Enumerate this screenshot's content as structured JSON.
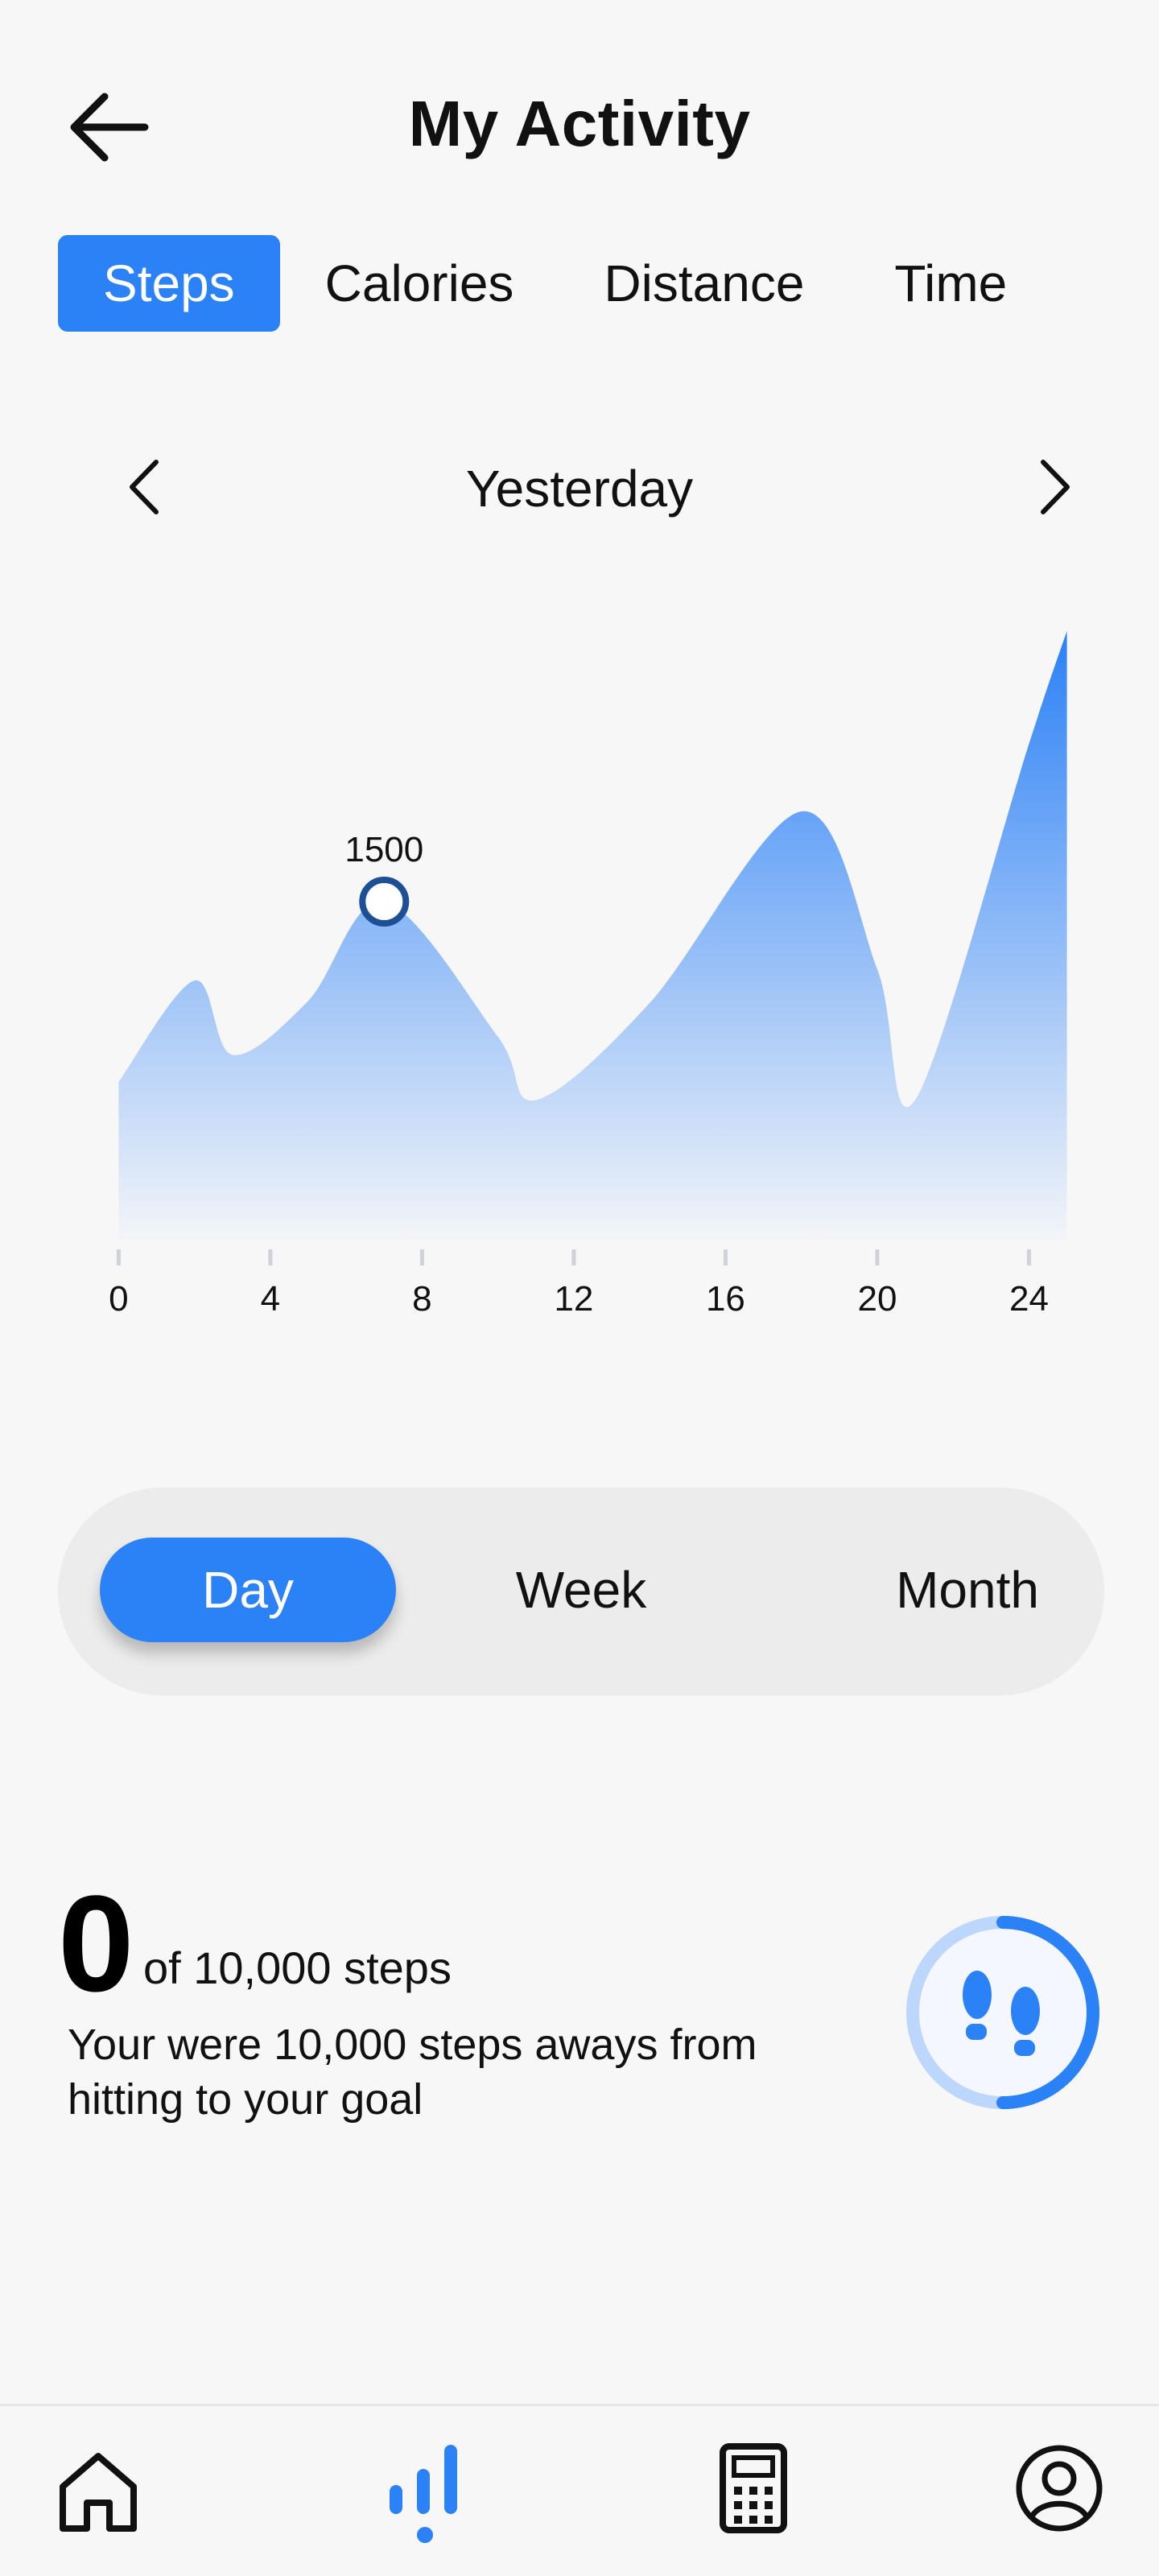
{
  "header": {
    "title": "My Activity",
    "back_icon": "arrow-left-icon"
  },
  "tabs": [
    {
      "label": "Steps",
      "active": true
    },
    {
      "label": "Calories",
      "active": false
    },
    {
      "label": "Distance",
      "active": false
    },
    {
      "label": "Time",
      "active": false
    }
  ],
  "date_nav": {
    "label": "Yesterday",
    "prev_icon": "chevron-left-icon",
    "next_icon": "chevron-right-icon"
  },
  "chart_data": {
    "type": "area",
    "x": [
      0,
      2,
      3,
      5,
      7,
      10,
      11,
      14,
      18,
      20,
      21,
      24,
      25
    ],
    "y": [
      700,
      1150,
      820,
      1060,
      1500,
      900,
      620,
      1050,
      1900,
      1200,
      620,
      2200,
      2700
    ],
    "ticks": [
      0,
      4,
      8,
      12,
      16,
      20,
      24
    ],
    "xlim": [
      -1.6,
      25.9
    ],
    "ylim": [
      0,
      3000
    ],
    "highlight": {
      "x": 7,
      "y": 1500,
      "label": "1500"
    },
    "grid": false,
    "fill_color": "#2b81f6"
  },
  "period": {
    "options": [
      {
        "label": "Day",
        "active": true
      },
      {
        "label": "Week",
        "active": false
      },
      {
        "label": "Month",
        "active": false
      }
    ]
  },
  "summary": {
    "count": "0",
    "goal_text": "of 10,000 steps",
    "message": "Your were 10,000 steps aways from hitting to your goal",
    "progress_fraction": 0.5,
    "icon": "footprints-icon"
  },
  "bottom_nav": {
    "items": [
      {
        "icon": "home-icon",
        "active": false
      },
      {
        "icon": "stats-bars-icon",
        "active": true
      },
      {
        "icon": "calculator-icon",
        "active": false
      },
      {
        "icon": "profile-icon",
        "active": false
      }
    ]
  },
  "colors": {
    "accent": "#2b81f6",
    "accent_light": "#bcd7fb",
    "text": "#111111",
    "background": "#f7f7f8"
  }
}
